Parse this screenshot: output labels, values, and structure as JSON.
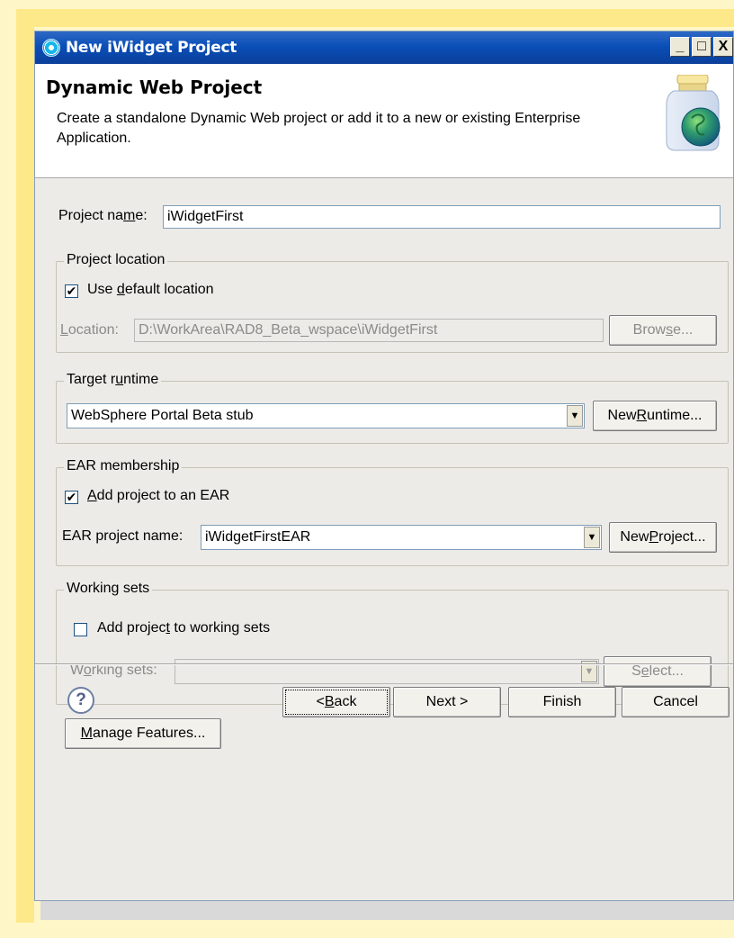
{
  "window": {
    "title": "New iWidget Project",
    "controls": {
      "minimize": "_",
      "maximize": "□",
      "close": "X"
    }
  },
  "header": {
    "title": "Dynamic Web Project",
    "description": "Create a standalone Dynamic Web project or add it to a new or existing Enterprise Application."
  },
  "project_name": {
    "label_pre": "Project na",
    "label_accel": "m",
    "label_post": "e:",
    "value": "iWidgetFirst"
  },
  "project_location": {
    "legend": "Project location",
    "use_default": {
      "checked": true,
      "label_pre": "Use ",
      "label_accel": "d",
      "label_post": "efault location"
    },
    "location_label_accel": "L",
    "location_label_post": "ocation:",
    "location_value": "D:\\WorkArea\\RAD8_Beta_wspace\\iWidgetFirst",
    "browse_pre": "Brow",
    "browse_accel": "s",
    "browse_post": "e..."
  },
  "target_runtime": {
    "legend_pre": "Target r",
    "legend_accel": "u",
    "legend_post": "ntime",
    "selected": "WebSphere Portal Beta stub",
    "new_runtime_pre": "New ",
    "new_runtime_accel": "R",
    "new_runtime_post": "untime..."
  },
  "ear_membership": {
    "legend": "EAR membership",
    "add_to_ear": {
      "checked": true,
      "label_pre": "",
      "label_accel": "A",
      "label_post": "dd project to an EAR"
    },
    "name_label_pre": "EAR pro",
    "name_label_accel": "j",
    "name_label_post": "ect name:",
    "selected": "iWidgetFirstEAR",
    "new_project_pre": "New ",
    "new_project_accel": "P",
    "new_project_post": "roject..."
  },
  "working_sets": {
    "legend": "Working sets",
    "add_to_ws": {
      "checked": false,
      "label_pre": "Add projec",
      "label_accel": "t",
      "label_post": " to working sets"
    },
    "label_pre": "W",
    "label_accel": "o",
    "label_post": "rking sets:",
    "selected": "",
    "select_pre": "S",
    "select_accel": "e",
    "select_post": "lect..."
  },
  "manage_features": {
    "accel": "M",
    "post": "anage Features..."
  },
  "footer": {
    "help_symbol": "?",
    "back_pre": "< ",
    "back_accel": "B",
    "back_post": "ack",
    "next": "Next >",
    "finish": "Finish",
    "cancel": "Cancel"
  },
  "colors": {
    "titlebar": "#0a4fb8",
    "window": "#ecebe7",
    "backdrop": "#fde98a"
  }
}
